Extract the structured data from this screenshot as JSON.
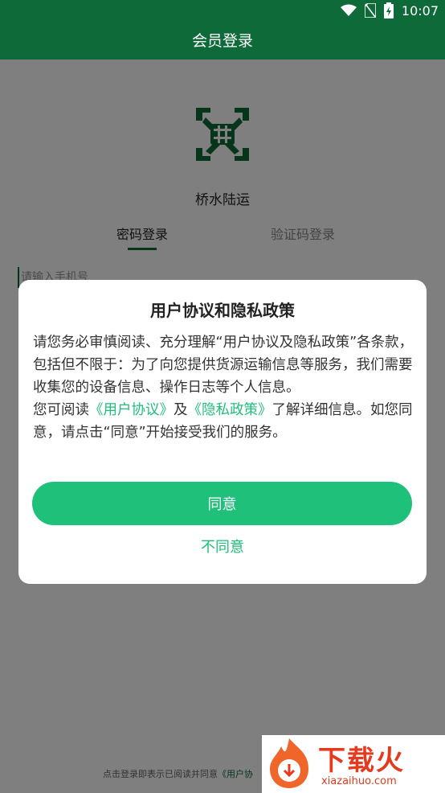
{
  "status_bar": {
    "time": "10:07"
  },
  "app_bar": {
    "title": "会员登录"
  },
  "login": {
    "app_name": "桥水陆运",
    "tabs": [
      "密码登录",
      "验证码登录"
    ],
    "phone_placeholder": "请输入手机号",
    "footer_prefix": "点击登录即表示已阅读并同意",
    "footer_link": "《用户协"
  },
  "dialog": {
    "title": "用户协议和隐私政策",
    "para1": "请您务必审慎阅读、充分理解“用户协议及隐私政策”各条款，包括但不限于：为了向您提供货源运输信息等服务，我们需要收集您的设备信息、操作日志等个人信息。",
    "para2_a": "您可阅读",
    "link_terms": "《用户协议》",
    "para2_b": "及",
    "link_privacy": "《隐私政策》",
    "para2_c": "了解详细信息。如您同意，请点击“同意”开始接受我们的服务。",
    "agree_label": "同意",
    "disagree_label": "不同意"
  },
  "watermark": {
    "title": "下载火",
    "subtitle": "xiazaihuo.com"
  },
  "colors": {
    "brand_dark": "#0e6a38",
    "accent": "#1fc07a",
    "watermark": "#e63a1f"
  }
}
